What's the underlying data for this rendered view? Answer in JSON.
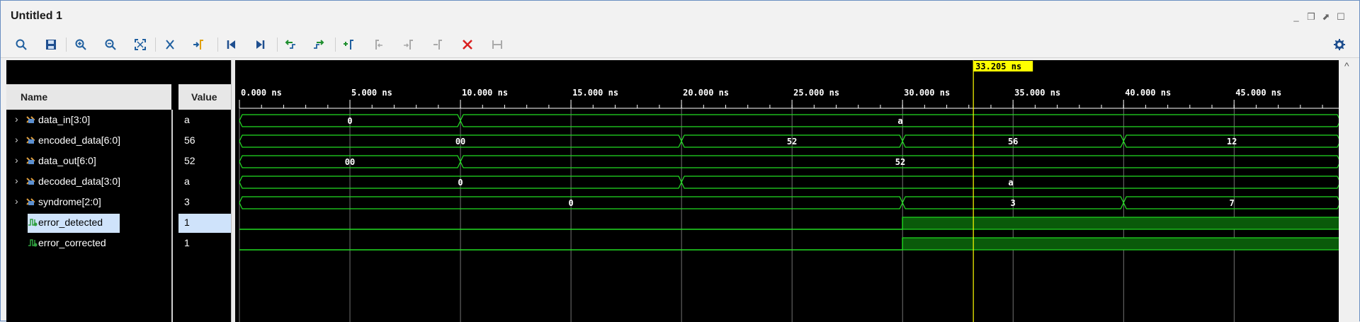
{
  "window": {
    "title": "Untitled 1"
  },
  "toolbar": {
    "buttons": [
      "search-icon",
      "save-icon",
      "zoom-in-icon",
      "zoom-out-icon",
      "zoom-fit-icon",
      "swap-cursor-icon",
      "go-to-cursor-icon",
      "go-to-start-icon",
      "go-to-end-icon",
      "previous-transition-icon",
      "next-transition-icon",
      "add-marker-icon",
      "previous-marker-icon",
      "next-marker-icon",
      "swap-marker-icon",
      "delete-icon",
      "snap-icon"
    ],
    "settings": "gear-icon"
  },
  "columns": {
    "name": "Name",
    "value": "Value"
  },
  "cursor": {
    "label": "33.205 ns",
    "time_ns": 33.205,
    "color": "#ffff00"
  },
  "timeline": {
    "start_ns": 0,
    "end_ns": 49.8,
    "tick_labels": [
      "0.000 ns",
      "5.000 ns",
      "10.000 ns",
      "15.000 ns",
      "20.000 ns",
      "25.000 ns",
      "30.000 ns",
      "35.000 ns",
      "40.000 ns",
      "45.000 ns"
    ],
    "tick_values": [
      0,
      5,
      10,
      15,
      20,
      25,
      30,
      35,
      40,
      45
    ]
  },
  "signals": [
    {
      "name": "data_in[3:0]",
      "value": "a",
      "kind": "bus",
      "segments": [
        {
          "start": 0,
          "end": 10,
          "label": "0"
        },
        {
          "start": 10,
          "end": 49.8,
          "label": "a"
        }
      ]
    },
    {
      "name": "encoded_data[6:0]",
      "value": "56",
      "kind": "bus",
      "segments": [
        {
          "start": 0,
          "end": 20,
          "label": "00"
        },
        {
          "start": 20,
          "end": 30,
          "label": "52"
        },
        {
          "start": 30,
          "end": 40,
          "label": "56"
        },
        {
          "start": 40,
          "end": 49.8,
          "label": "12"
        }
      ]
    },
    {
      "name": "data_out[6:0]",
      "value": "52",
      "kind": "bus",
      "segments": [
        {
          "start": 0,
          "end": 10,
          "label": "00"
        },
        {
          "start": 10,
          "end": 49.8,
          "label": "52"
        }
      ]
    },
    {
      "name": "decoded_data[3:0]",
      "value": "a",
      "kind": "bus",
      "segments": [
        {
          "start": 0,
          "end": 20,
          "label": "0"
        },
        {
          "start": 20,
          "end": 49.8,
          "label": "a"
        }
      ]
    },
    {
      "name": "syndrome[2:0]",
      "value": "3",
      "kind": "bus",
      "segments": [
        {
          "start": 0,
          "end": 30,
          "label": "0"
        },
        {
          "start": 30,
          "end": 40,
          "label": "3"
        },
        {
          "start": 40,
          "end": 49.8,
          "label": "7"
        }
      ]
    },
    {
      "name": "error_detected",
      "value": "1",
      "kind": "bit",
      "selected": true,
      "high_from": 30
    },
    {
      "name": "error_corrected",
      "value": "1",
      "kind": "bit",
      "selected": false,
      "high_from": 30
    }
  ],
  "colors": {
    "wave": "#22dd22",
    "high_fill": "#0a5a0a",
    "grid": "#ffffff",
    "cursor": "#ffff00",
    "selection": "#cfe3fb"
  }
}
